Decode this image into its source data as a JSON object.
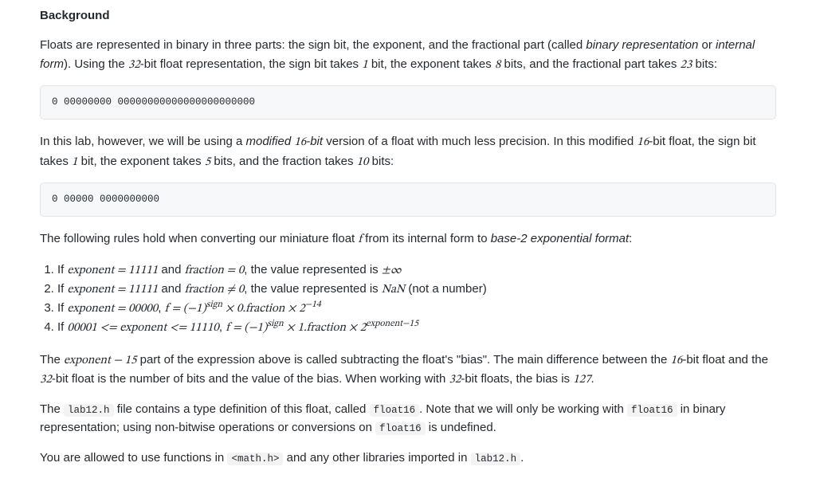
{
  "heading": "Background",
  "intro": {
    "prefix": "Floats are represented in binary in three parts: the sign bit, the exponent, and the fractional part (called ",
    "term1": "binary representation",
    "middle1": " or ",
    "term2": "internal form",
    "after_terms": "). Using the ",
    "bits_total": "32",
    "after_total": "-bit float representation, the sign bit takes ",
    "sign_bits": "1",
    "after_sign": " bit, the exponent takes ",
    "exp_bits": "8",
    "after_exp": " bits, and the fractional part takes ",
    "frac_bits": "23",
    "suffix": " bits:"
  },
  "code32": "0 00000000 00000000000000000000000",
  "lab_note": {
    "prefix": "In this lab, however, we will be using a ",
    "modified_word": "modified ",
    "bits_total": "16",
    "after_total_italic": "-bit",
    "after_italic": " version of a float with much less precision. In this modified ",
    "bits_total2": "16",
    "after_total2": "-bit float, the sign bit takes ",
    "sign_bits": "1",
    "after_sign": " bit, the exponent takes ",
    "exp_bits": "5",
    "after_exp": " bits, and the fraction takes ",
    "frac_bits": "10",
    "suffix": " bits:"
  },
  "code16": "0 00000 0000000000",
  "rules_intro": {
    "prefix": "The following rules hold when converting our miniature float ",
    "var_f": "f",
    "middle": " from its internal form to ",
    "term": "base-2 exponential format",
    "suffix": ":"
  },
  "rules": [
    {
      "prefix": "If ",
      "expr_lhs": "exponent",
      "eq1": " = ",
      "val1": "11111",
      "and": " and ",
      "expr_rhs": "fraction",
      "eq2": " = ",
      "val2": "0",
      "result_prefix": ", the value represented is ",
      "result": "±∞"
    },
    {
      "prefix": "If ",
      "expr_lhs": "exponent",
      "eq1": " = ",
      "val1": "11111",
      "and": " and ",
      "expr_rhs": "fraction",
      "neq": " ≠ ",
      "val2": "0",
      "result_prefix": ", the value represented is ",
      "nan": "NaN",
      "nan_suffix": " (not a number)"
    },
    {
      "prefix": "If ",
      "expr_lhs": "exponent",
      "eq1": " = ",
      "val1": "00000",
      "comma": ", ",
      "f": "f",
      "eq2": " = ",
      "neg1_base": "(−1)",
      "sup_sign": "sign",
      "times1": " × ",
      "zeropoint": "0.",
      "fraction_word": "fraction",
      "times2": " × ",
      "two": "2",
      "sup_exp": "−14"
    },
    {
      "prefix": "If ",
      "lo": "00001",
      "le1": " <= ",
      "expr_mid": "exponent",
      "le2": " <= ",
      "hi": "11110",
      "comma": ", ",
      "f": "f",
      "eq2": " = ",
      "neg1_base": "(−1)",
      "sup_sign": "sign",
      "times1": " × ",
      "onepoint": "1.",
      "fraction_word": "fraction",
      "times2": " × ",
      "two": "2",
      "sup_exp": "exponent−15"
    }
  ],
  "bias_para": {
    "prefix": "The ",
    "expr": "exponent − 15",
    "middle1": " part of the expression above is called subtracting the float's \"bias\". The main difference between the ",
    "b16": "16",
    "middle2": "-bit float and the ",
    "b32": "32",
    "middle3": "-bit float is the number of bits and the value of the bias. When working with ",
    "b32b": "32",
    "middle4": "-bit floats, the bias is ",
    "bias_val": "127",
    "suffix": "."
  },
  "file_para": {
    "prefix": "The ",
    "code1": "lab12.h",
    "mid1": " file contains a type definition of this float, called ",
    "code2": "float16",
    "mid2": ". Note that we will only be working with ",
    "code3": "float16",
    "mid3": " in binary representation; using non-bitwise operations or conversions on ",
    "code4": "float16",
    "suffix": " is undefined."
  },
  "allowed_para": {
    "prefix": "You are allowed to use functions in ",
    "code1": "<math.h>",
    "mid": " and any other libraries imported in ",
    "code2": "lab12.h",
    "suffix": "."
  }
}
